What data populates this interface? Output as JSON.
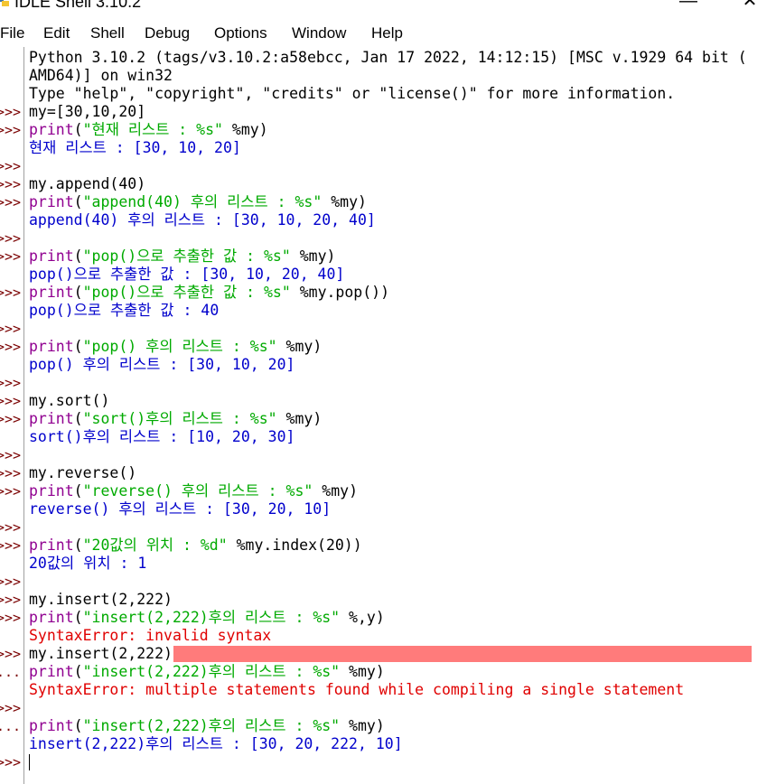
{
  "window": {
    "title": "IDLE Shell 3.10.2",
    "minimize": "—",
    "close": "✕"
  },
  "menu": [
    "File",
    "Edit",
    "Shell",
    "Debug",
    "Options",
    "Window",
    "Help"
  ],
  "colors": {
    "output": "#0000cc",
    "error": "#e00000",
    "string": "#00aa00",
    "builtin": "#900090",
    "prompt": "#7a0000",
    "error_highlight": "#ff7b7b"
  },
  "lines": [
    {
      "prompt": "",
      "parts": [
        {
          "t": "Python 3.10.2 (tags/v3.10.2:a58ebcc, Jan 17 2022, 14:12:15) [MSC v.1929 64 bit (",
          "c": "normal"
        }
      ]
    },
    {
      "prompt": "",
      "parts": [
        {
          "t": "AMD64)] on win32",
          "c": "normal"
        }
      ]
    },
    {
      "prompt": "",
      "parts": [
        {
          "t": "Type \"help\", \"copyright\", \"credits\" or \"license()\" for more information.",
          "c": "normal"
        }
      ]
    },
    {
      "prompt": ">>>",
      "parts": [
        {
          "t": "my=[30,10,20]",
          "c": "normal"
        }
      ]
    },
    {
      "prompt": ">>>",
      "parts": [
        {
          "t": "print",
          "c": "builtin"
        },
        {
          "t": "(",
          "c": "normal"
        },
        {
          "t": "\"현재 리스트 : %s\"",
          "c": "string"
        },
        {
          "t": " %my)",
          "c": "normal"
        }
      ]
    },
    {
      "prompt": "",
      "parts": [
        {
          "t": "현재 리스트 : [30, 10, 20]",
          "c": "out"
        }
      ]
    },
    {
      "prompt": ">>>",
      "parts": []
    },
    {
      "prompt": ">>>",
      "parts": [
        {
          "t": "my.append(40)",
          "c": "normal"
        }
      ]
    },
    {
      "prompt": ">>>",
      "parts": [
        {
          "t": "print",
          "c": "builtin"
        },
        {
          "t": "(",
          "c": "normal"
        },
        {
          "t": "\"append(40) 후의 리스트 : %s\"",
          "c": "string"
        },
        {
          "t": " %my)",
          "c": "normal"
        }
      ]
    },
    {
      "prompt": "",
      "parts": [
        {
          "t": "append(40) 후의 리스트 : [30, 10, 20, 40]",
          "c": "out"
        }
      ]
    },
    {
      "prompt": ">>>",
      "parts": []
    },
    {
      "prompt": ">>>",
      "parts": [
        {
          "t": "print",
          "c": "builtin"
        },
        {
          "t": "(",
          "c": "normal"
        },
        {
          "t": "\"pop()으로 추출한 값 : %s\"",
          "c": "string"
        },
        {
          "t": " %my)",
          "c": "normal"
        }
      ]
    },
    {
      "prompt": "",
      "parts": [
        {
          "t": "pop()으로 추출한 값 : [30, 10, 20, 40]",
          "c": "out"
        }
      ]
    },
    {
      "prompt": ">>>",
      "parts": [
        {
          "t": "print",
          "c": "builtin"
        },
        {
          "t": "(",
          "c": "normal"
        },
        {
          "t": "\"pop()으로 추출한 값 : %s\"",
          "c": "string"
        },
        {
          "t": " %my.pop())",
          "c": "normal"
        }
      ]
    },
    {
      "prompt": "",
      "parts": [
        {
          "t": "pop()으로 추출한 값 : 40",
          "c": "out"
        }
      ]
    },
    {
      "prompt": ">>>",
      "parts": []
    },
    {
      "prompt": ">>>",
      "parts": [
        {
          "t": "print",
          "c": "builtin"
        },
        {
          "t": "(",
          "c": "normal"
        },
        {
          "t": "\"pop() 후의 리스트 : %s\"",
          "c": "string"
        },
        {
          "t": " %my)",
          "c": "normal"
        }
      ]
    },
    {
      "prompt": "",
      "parts": [
        {
          "t": "pop() 후의 리스트 : [30, 10, 20]",
          "c": "out"
        }
      ]
    },
    {
      "prompt": ">>>",
      "parts": []
    },
    {
      "prompt": ">>>",
      "parts": [
        {
          "t": "my.sort()",
          "c": "normal"
        }
      ]
    },
    {
      "prompt": ">>>",
      "parts": [
        {
          "t": "print",
          "c": "builtin"
        },
        {
          "t": "(",
          "c": "normal"
        },
        {
          "t": "\"sort()후의 리스트 : %s\"",
          "c": "string"
        },
        {
          "t": " %my)",
          "c": "normal"
        }
      ]
    },
    {
      "prompt": "",
      "parts": [
        {
          "t": "sort()후의 리스트 : [10, 20, 30]",
          "c": "out"
        }
      ]
    },
    {
      "prompt": ">>>",
      "parts": []
    },
    {
      "prompt": ">>>",
      "parts": [
        {
          "t": "my.reverse()",
          "c": "normal"
        }
      ]
    },
    {
      "prompt": ">>>",
      "parts": [
        {
          "t": "print",
          "c": "builtin"
        },
        {
          "t": "(",
          "c": "normal"
        },
        {
          "t": "\"reverse() 후의 리스트 : %s\"",
          "c": "string"
        },
        {
          "t": " %my)",
          "c": "normal"
        }
      ]
    },
    {
      "prompt": "",
      "parts": [
        {
          "t": "reverse() 후의 리스트 : [30, 20, 10]",
          "c": "out"
        }
      ]
    },
    {
      "prompt": ">>>",
      "parts": []
    },
    {
      "prompt": ">>>",
      "parts": [
        {
          "t": "print",
          "c": "builtin"
        },
        {
          "t": "(",
          "c": "normal"
        },
        {
          "t": "\"20값의 위치 : %d\"",
          "c": "string"
        },
        {
          "t": " %my.index(20))",
          "c": "normal"
        }
      ]
    },
    {
      "prompt": "",
      "parts": [
        {
          "t": "20값의 위치 : 1",
          "c": "out"
        }
      ]
    },
    {
      "prompt": ">>>",
      "parts": []
    },
    {
      "prompt": ">>>",
      "parts": [
        {
          "t": "my.insert(2,222)",
          "c": "normal"
        }
      ]
    },
    {
      "prompt": ">>>",
      "parts": [
        {
          "t": "print",
          "c": "builtin"
        },
        {
          "t": "(",
          "c": "normal"
        },
        {
          "t": "\"insert(2,222)후의 리스트 : %s\"",
          "c": "string"
        },
        {
          "t": " %,y)",
          "c": "normal"
        }
      ]
    },
    {
      "prompt": "",
      "parts": [
        {
          "t": "SyntaxError: invalid syntax",
          "c": "err"
        }
      ]
    },
    {
      "prompt": ">>>",
      "parts": [
        {
          "t": "my.insert(2,222)",
          "c": "normal"
        }
      ],
      "highlight": true
    },
    {
      "prompt": "...",
      "parts": [
        {
          "t": "print",
          "c": "builtin"
        },
        {
          "t": "(",
          "c": "normal"
        },
        {
          "t": "\"insert(2,222)후의 리스트 : %s\"",
          "c": "string"
        },
        {
          "t": " %my)",
          "c": "normal"
        }
      ]
    },
    {
      "prompt": "",
      "parts": [
        {
          "t": "SyntaxError: multiple statements found while compiling a single statement",
          "c": "err"
        }
      ]
    },
    {
      "prompt": ">>>",
      "parts": []
    },
    {
      "prompt": "...",
      "parts": [
        {
          "t": "print",
          "c": "builtin"
        },
        {
          "t": "(",
          "c": "normal"
        },
        {
          "t": "\"insert(2,222)후의 리스트 : %s\"",
          "c": "string"
        },
        {
          "t": " %my)",
          "c": "normal"
        }
      ]
    },
    {
      "prompt": "",
      "parts": [
        {
          "t": "insert(2,222)후의 리스트 : [30, 20, 222, 10]",
          "c": "out"
        }
      ]
    },
    {
      "prompt": ">>>",
      "parts": [],
      "cursor": true
    }
  ]
}
